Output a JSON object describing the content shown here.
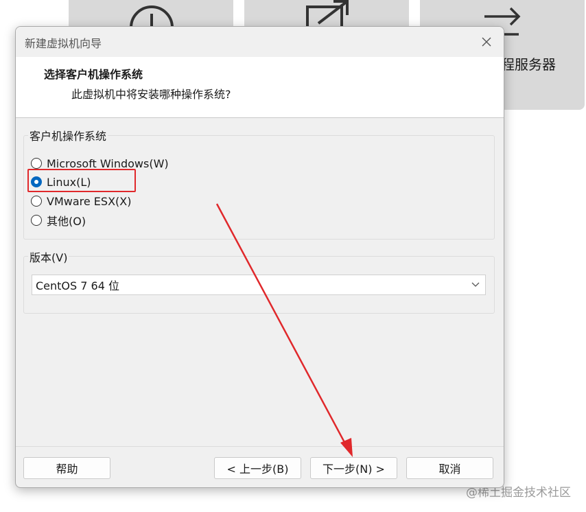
{
  "background": {
    "tile3_text": "程服务器",
    "watermark": "@稀土掘金技术社区"
  },
  "dialog": {
    "title": "新建虚拟机向导",
    "header_title": "选择客户机操作系统",
    "header_subtitle": "此虚拟机中将安装哪种操作系统?",
    "os_group_label": "客户机操作系统",
    "os_options": [
      {
        "label": "Microsoft Windows(W)",
        "checked": false
      },
      {
        "label": "Linux(L)",
        "checked": true
      },
      {
        "label": "VMware ESX(X)",
        "checked": false
      },
      {
        "label": "其他(O)",
        "checked": false
      }
    ],
    "version_group_label": "版本(V)",
    "version_value": "CentOS 7 64 位",
    "buttons": {
      "help": "帮助",
      "back": "< 上一步(B)",
      "next": "下一步(N) >",
      "cancel": "取消"
    }
  },
  "colors": {
    "accent": "#0067c0",
    "annotation": "#e0282b"
  },
  "icons": [
    "plus-circle-icon",
    "open-external-icon",
    "transfer-arrow-icon",
    "close-icon",
    "chevron-down-icon"
  ]
}
